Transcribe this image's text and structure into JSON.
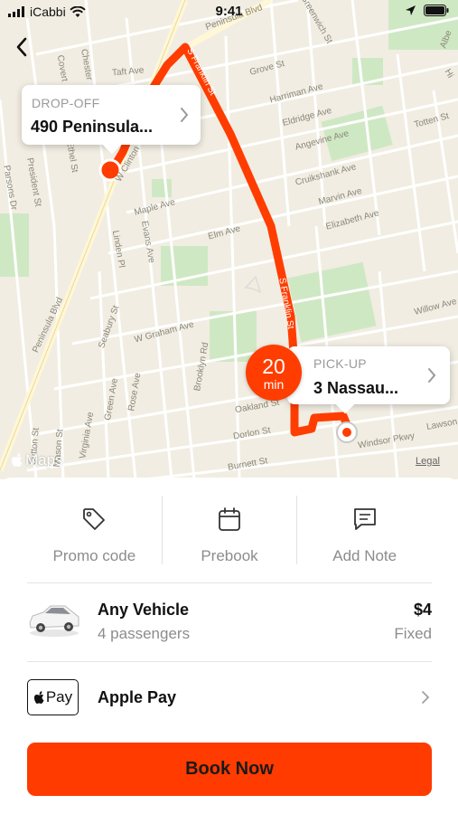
{
  "status_bar": {
    "carrier": "iCabbi",
    "time": "9:41"
  },
  "map": {
    "attribution": "Maps",
    "legal": "Legal",
    "route_color": "#ff3d00",
    "street_labels": [
      "Peninsula Blvd",
      "Greenwich St",
      "S Franklin St",
      "Taft Ave",
      "Grove St",
      "Harriman Ave",
      "Eldridge Ave",
      "Angevine Ave",
      "Totten St",
      "Cruikshank Ave",
      "Marvin Ave",
      "Elizabeth Ave",
      "Maple Ave",
      "Elm Ave",
      "Evans Ave",
      "Linden Pl",
      "President St",
      "Parsons Dr",
      "Peninsula Blvd",
      "Seabury St",
      "W Graham Ave",
      "Willow Ave",
      "S Franklin St",
      "Brooklyn Rd",
      "Oakland St",
      "Dorlon St",
      "Burnett St",
      "Windsor Pkwy",
      "Lawson",
      "Green Ave",
      "Rose Ave",
      "Virginia Ave",
      "Mason St",
      "Sutton St",
      "Covert",
      "Chester",
      "Albe",
      "Ethel St",
      "W Clinton",
      "Hi"
    ],
    "dropoff": {
      "kicker": "DROP-OFF",
      "title": "490 Peninsula..."
    },
    "pickup": {
      "kicker": "PICK-UP",
      "title": "3 Nassau..."
    },
    "eta": {
      "value": "20",
      "unit": "min"
    }
  },
  "options": [
    {
      "label": "Promo code",
      "icon": "tag-icon"
    },
    {
      "label": "Prebook",
      "icon": "calendar-icon"
    },
    {
      "label": "Add Note",
      "icon": "note-icon"
    }
  ],
  "vehicle": {
    "name": "Any Vehicle",
    "passengers": "4 passengers",
    "price": "$4",
    "price_type": "Fixed"
  },
  "payment": {
    "badge_text": "Pay",
    "label": "Apple Pay"
  },
  "book_button": {
    "label": "Book Now",
    "color": "#ff3b00"
  }
}
